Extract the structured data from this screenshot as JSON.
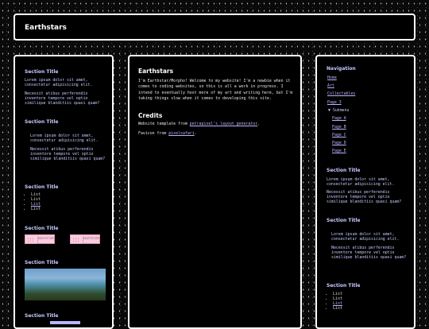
{
  "header": {
    "title": "Earthstars"
  },
  "left": {
    "section1": {
      "title": "Section Title",
      "p1": "Lorem ipsum dolor sit amet, consectetur adipisicing elit.",
      "p2": "Necessit atibus perferendis inventore tempore vel optio similique blanditiis quasi quam?"
    },
    "section2": {
      "title": "Section Title",
      "p1": "Lorem ipsum dolor sit amet, consectetur adipisicing elit.",
      "p2": "Necessit atibus perferendis inventore tempore vel optio similique blanditiis quasi quam?"
    },
    "section3": {
      "title": "Section Title",
      "items": [
        "List",
        "List",
        "List",
        "List"
      ]
    },
    "section4": {
      "title": "Section Title",
      "badge_text": "peacock.petal"
    },
    "section5": {
      "title": "Section Title"
    },
    "section6": {
      "title": "Section Title"
    }
  },
  "main": {
    "title": "Earthstars",
    "intro": "I'm Earthstar/Morpho! Welcome to my website! I'm a newbie when it comes to coding websites, so this is all a work in progress. I intend to eventually host more of my art and writing here, but I'm taking things slow when it comes to developing this site.",
    "credits_title": "Credits",
    "credit1_prefix": "Website template from ",
    "credit1_link": "petrapixel's layout generator",
    "credit1_suffix": ".",
    "credit2_prefix": "Favicon from ",
    "credit2_link": "pixelsafari",
    "credit2_suffix": "."
  },
  "right": {
    "nav_title": "Navigation",
    "nav": [
      "Home",
      "Art",
      "Collectables",
      "Page 3"
    ],
    "submenu_label": "▼ Submenu",
    "subnav": [
      "Page A",
      "Page B",
      "Page C",
      "Page D",
      "Page E"
    ],
    "section1": {
      "title": "Section Title",
      "p1": "Lorem ipsum dolor sit amet, consectetur adipisicing elit.",
      "p2": "Necessit atibus perferendis inventore tempore vel optio similique blanditiis quasi quam?"
    },
    "section2": {
      "title": "Section Title",
      "p1": "Lorem ipsum dolor sit amet, consectetur adipisicing elit.",
      "p2": "Necessit atibus perferendis inventore tempore vel optio similique blanditiis quasi quam?"
    },
    "section3": {
      "title": "Section Title",
      "items": [
        "List",
        "List",
        "List",
        "List"
      ]
    }
  },
  "colors": {
    "accent": "#c6cbff",
    "link": "#b9b4ff",
    "border": "#ffffff",
    "badge": "#f7cde0"
  }
}
